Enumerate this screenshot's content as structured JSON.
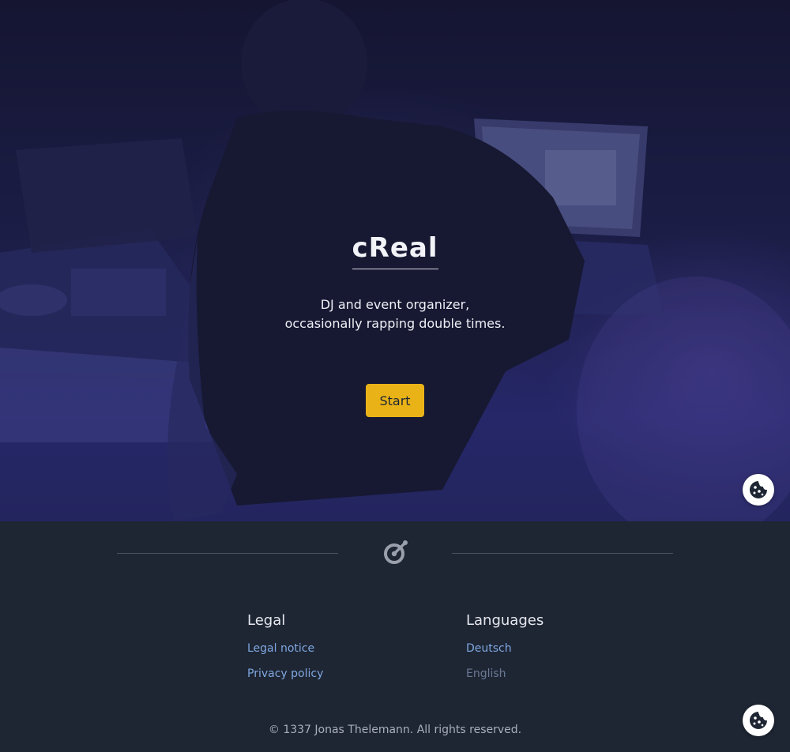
{
  "hero": {
    "title": "cReal",
    "subtitle_line1": "DJ and event organizer,",
    "subtitle_line2": "occasionally rapping double times.",
    "start_label": "Start"
  },
  "footer": {
    "legal": {
      "heading": "Legal",
      "links": [
        "Legal notice",
        "Privacy policy"
      ]
    },
    "languages": {
      "heading": "Languages",
      "links": [
        "Deutsch",
        "English"
      ],
      "active": "English"
    },
    "copyright": "© 1337 Jonas Thelemann. All rights reserved."
  },
  "icons": {
    "cookie": "cookie-icon",
    "logo": "logo-icon"
  },
  "colors": {
    "accent": "#e9b318",
    "link": "#7fa8e0",
    "footer_bg": "#1e2533"
  }
}
